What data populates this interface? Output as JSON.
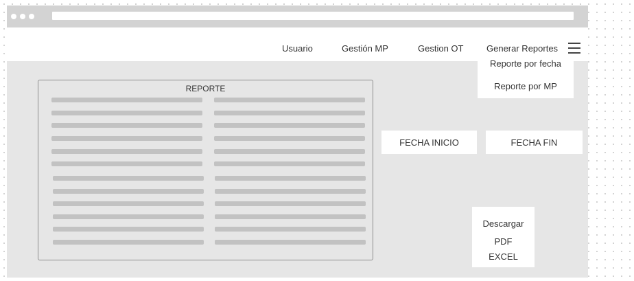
{
  "nav": {
    "items": [
      "Usuario",
      "Gestión MP",
      "Gestion OT",
      "Generar Reportes"
    ],
    "menu_icon": "hamburger-icon"
  },
  "dropdown": {
    "items": [
      "Reporte por fecha",
      "Reporte por MP"
    ]
  },
  "report": {
    "title": "REPORTE"
  },
  "filters": {
    "start_label": "FECHA INICIO",
    "end_label": "FECHA FIN"
  },
  "download": {
    "title": "Descargar",
    "options": [
      "PDF",
      "EXCEL"
    ]
  }
}
